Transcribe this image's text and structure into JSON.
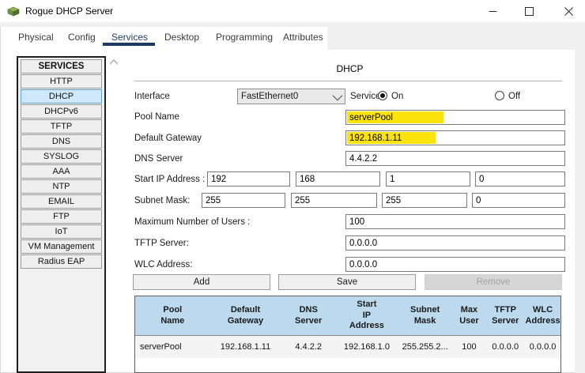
{
  "window": {
    "title": "Rogue DHCP Server",
    "controls": {
      "minimize": "minimize",
      "maximize": "maximize",
      "close": "close"
    }
  },
  "tabs": [
    {
      "label": "Physical",
      "active": false
    },
    {
      "label": "Config",
      "active": false
    },
    {
      "label": "Services",
      "active": true
    },
    {
      "label": "Desktop",
      "active": false
    },
    {
      "label": "Programming",
      "active": false
    },
    {
      "label": "Attributes",
      "active": false
    }
  ],
  "sidebar": {
    "header": "SERVICES",
    "selected": "DHCP",
    "items": [
      {
        "label": "HTTP",
        "selected": false
      },
      {
        "label": "DHCP",
        "selected": true
      },
      {
        "label": "DHCPv6",
        "selected": false
      },
      {
        "label": "TFTP",
        "selected": false
      },
      {
        "label": "DNS",
        "selected": false
      },
      {
        "label": "SYSLOG",
        "selected": false
      },
      {
        "label": "AAA",
        "selected": false
      },
      {
        "label": "NTP",
        "selected": false
      },
      {
        "label": "EMAIL",
        "selected": false
      },
      {
        "label": "FTP",
        "selected": false
      },
      {
        "label": "IoT",
        "selected": false
      },
      {
        "label": "VM Management",
        "selected": false
      },
      {
        "label": "Radius EAP",
        "selected": false
      }
    ]
  },
  "main": {
    "heading": "DHCP",
    "interface": {
      "label": "Interface",
      "value": "FastEthernet0"
    },
    "service": {
      "label": "Service",
      "on_label": "On",
      "off_label": "Off",
      "selected": "On"
    },
    "fields": {
      "pool_name": {
        "label": "Pool Name",
        "value": "serverPool",
        "highlighted": true
      },
      "default_gateway": {
        "label": "Default Gateway",
        "value": "192.168.1.11",
        "highlighted": true
      },
      "dns_server": {
        "label": "DNS Server",
        "value": "4.4.2.2",
        "highlighted": false
      },
      "start_ip": {
        "label": "Start IP Address :",
        "octets": [
          "192",
          "168",
          "1",
          "0"
        ]
      },
      "subnet_mask": {
        "label": "Subnet Mask:",
        "octets": [
          "255",
          "255",
          "255",
          "0"
        ]
      },
      "max_users": {
        "label": "Maximum Number of Users :",
        "value": "100"
      },
      "tftp_server": {
        "label": "TFTP Server:",
        "value": "0.0.0.0"
      },
      "wlc_address": {
        "label": "WLC Address:",
        "value": "0.0.0.0"
      }
    },
    "buttons": {
      "add": "Add",
      "save": "Save",
      "remove": "Remove",
      "remove_disabled": true
    },
    "table": {
      "headers": [
        "Pool\nName",
        "Default\nGateway",
        "DNS\nServer",
        "Start\nIP\nAddress",
        "Subnet\nMask",
        "Max\nUser",
        "TFTP\nServer",
        "WLC\nAddress"
      ],
      "rows": [
        [
          "serverPool",
          "192.168.1.11",
          "4.4.2.2",
          "192.168.1.0",
          "255.255.2...",
          "100",
          "0.0.0.0",
          "0.0.0.0"
        ]
      ]
    }
  },
  "colors": {
    "accent_navy": "#1d3a5f",
    "highlight_yellow": "#fbe30b",
    "selected_item_blue": "#cfe8fb",
    "table_header_blue": "#bdd9ee"
  }
}
